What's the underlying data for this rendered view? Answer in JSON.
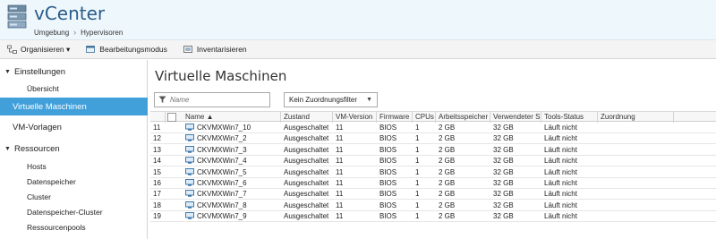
{
  "header": {
    "title": "vCenter",
    "breadcrumb": [
      "Umgebung",
      "Hypervisoren"
    ]
  },
  "toolbar": {
    "items": [
      "Organisieren ▾",
      "Bearbeitungsmodus",
      "Inventarisieren"
    ]
  },
  "sidebar": {
    "items": [
      {
        "label": "Einstellungen",
        "level": 0,
        "expanded": true
      },
      {
        "label": "Übersicht",
        "level": 1
      },
      {
        "label": "Virtuelle Maschinen",
        "level": 0,
        "selected": true
      },
      {
        "label": "VM-Vorlagen",
        "level": 0
      },
      {
        "label": "Ressourcen",
        "level": 0,
        "expanded": true
      },
      {
        "label": "Hosts",
        "level": 1
      },
      {
        "label": "Datenspeicher",
        "level": 1
      },
      {
        "label": "Cluster",
        "level": 1
      },
      {
        "label": "Datenspeicher-Cluster",
        "level": 1
      },
      {
        "label": "Ressourcenpools",
        "level": 1
      }
    ]
  },
  "main": {
    "title": "Virtuelle Maschinen",
    "search_placeholder": "Name",
    "filter_value": "Kein Zuordnungsfilter"
  },
  "table": {
    "columns": [
      "Name ▲",
      "Zustand",
      "VM-Version",
      "Firmware",
      "CPUs",
      "Arbeitsspeicher",
      "Verwendeter S",
      "Tools-Status",
      "Zuordnung"
    ],
    "rows": [
      {
        "num": "11",
        "name": "CKVMXWin7_10",
        "state": "Ausgeschaltet",
        "ver": "11",
        "fw": "BIOS",
        "cpu": "1",
        "mem": "2 GB",
        "used": "32 GB",
        "tools": "Läuft nicht",
        "assign": ""
      },
      {
        "num": "12",
        "name": "CKVMXWin7_2",
        "state": "Ausgeschaltet",
        "ver": "11",
        "fw": "BIOS",
        "cpu": "1",
        "mem": "2 GB",
        "used": "32 GB",
        "tools": "Läuft nicht",
        "assign": ""
      },
      {
        "num": "13",
        "name": "CKVMXWin7_3",
        "state": "Ausgeschaltet",
        "ver": "11",
        "fw": "BIOS",
        "cpu": "1",
        "mem": "2 GB",
        "used": "32 GB",
        "tools": "Läuft nicht",
        "assign": ""
      },
      {
        "num": "14",
        "name": "CKVMXWin7_4",
        "state": "Ausgeschaltet",
        "ver": "11",
        "fw": "BIOS",
        "cpu": "1",
        "mem": "2 GB",
        "used": "32 GB",
        "tools": "Läuft nicht",
        "assign": ""
      },
      {
        "num": "15",
        "name": "CKVMXWin7_5",
        "state": "Ausgeschaltet",
        "ver": "11",
        "fw": "BIOS",
        "cpu": "1",
        "mem": "2 GB",
        "used": "32 GB",
        "tools": "Läuft nicht",
        "assign": ""
      },
      {
        "num": "16",
        "name": "CKVMXWin7_6",
        "state": "Ausgeschaltet",
        "ver": "11",
        "fw": "BIOS",
        "cpu": "1",
        "mem": "2 GB",
        "used": "32 GB",
        "tools": "Läuft nicht",
        "assign": ""
      },
      {
        "num": "17",
        "name": "CKVMXWin7_7",
        "state": "Ausgeschaltet",
        "ver": "11",
        "fw": "BIOS",
        "cpu": "1",
        "mem": "2 GB",
        "used": "32 GB",
        "tools": "Läuft nicht",
        "assign": ""
      },
      {
        "num": "18",
        "name": "CKVMXWin7_8",
        "state": "Ausgeschaltet",
        "ver": "11",
        "fw": "BIOS",
        "cpu": "1",
        "mem": "2 GB",
        "used": "32 GB",
        "tools": "Läuft nicht",
        "assign": ""
      },
      {
        "num": "19",
        "name": "CKVMXWin7_9",
        "state": "Ausgeschaltet",
        "ver": "11",
        "fw": "BIOS",
        "cpu": "1",
        "mem": "2 GB",
        "used": "32 GB",
        "tools": "Läuft nicht",
        "assign": ""
      }
    ]
  },
  "colors": {
    "accent": "#41a0da",
    "title": "#2a5d8a",
    "header_bg": "#eef7fc"
  }
}
